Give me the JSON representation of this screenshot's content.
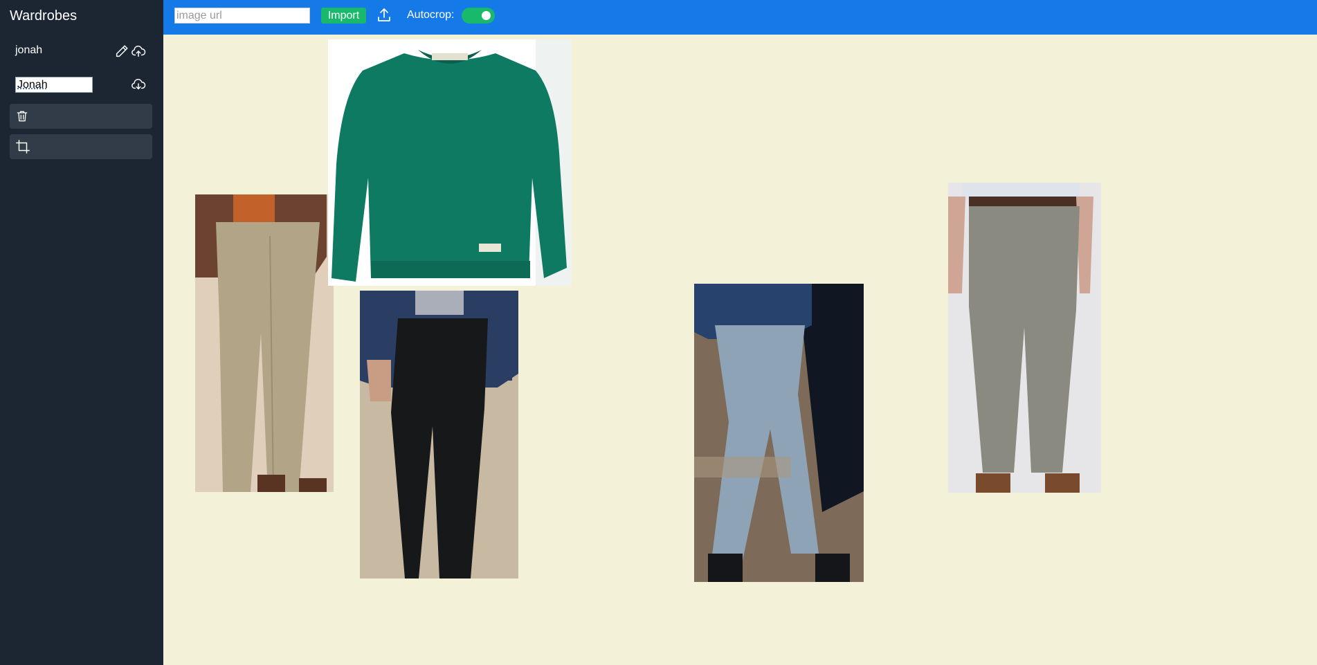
{
  "sidebar": {
    "title": "Wardrobes",
    "wardrobe_name": "jonah",
    "rename_value": "Jonah",
    "icons": {
      "edit": "pencil-icon",
      "upload": "cloud-upload-icon",
      "download": "cloud-download-icon",
      "delete": "trash-icon",
      "crop": "crop-icon"
    }
  },
  "toolbar": {
    "url_placeholder": "image url",
    "import_label": "Import",
    "upload_icon": "upload-icon",
    "autocrop_label": "Autocrop:",
    "autocrop_enabled": true
  },
  "canvas": {
    "items": [
      {
        "name": "khaki-chinos",
        "kind": "pants",
        "color": "#b1a487"
      },
      {
        "name": "green-sweatshirt",
        "kind": "sweatshirt",
        "color": "#0f7a62"
      },
      {
        "name": "black-chinos",
        "kind": "pants",
        "color": "#17181a"
      },
      {
        "name": "light-blue-chinos",
        "kind": "pants",
        "color": "#8ea3b5"
      },
      {
        "name": "gray-chinos",
        "kind": "pants",
        "color": "#8b8a80"
      }
    ]
  },
  "colors": {
    "sidebar_bg": "#1c2633",
    "topbar_bg": "#157ae8",
    "accent_green": "#18b96a",
    "canvas_bg": "#f3f1d8"
  }
}
